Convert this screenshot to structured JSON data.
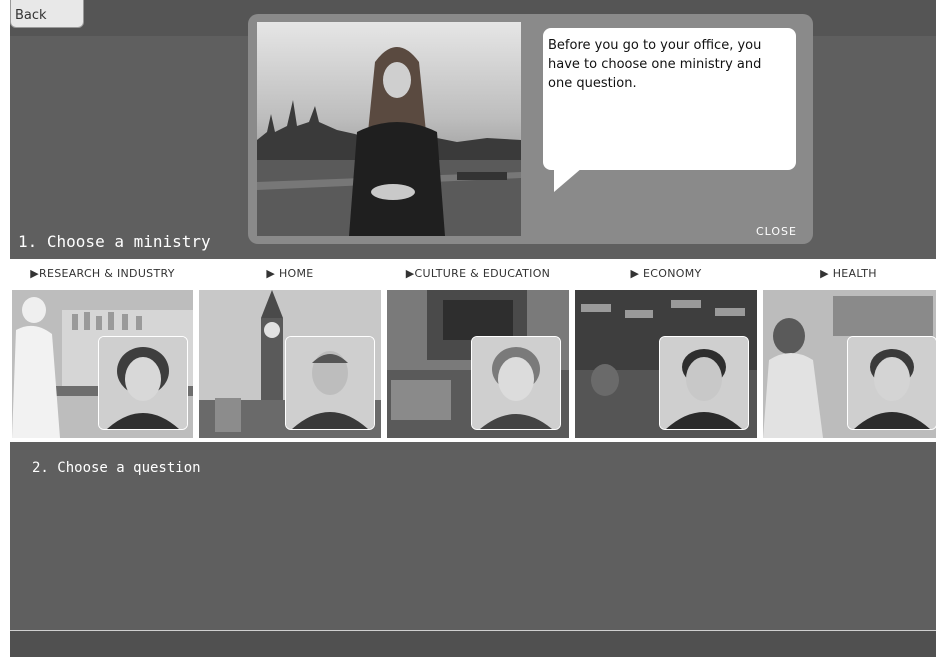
{
  "nav": {
    "back_label": "Back"
  },
  "dialog": {
    "message": "Before you go to your office, you have to choose one ministry and one question.",
    "close_label": "CLOSE"
  },
  "section1": {
    "title": "1. Choose a ministry"
  },
  "ministries": [
    {
      "label": "▶RESEARCH & INDUSTRY"
    },
    {
      "label": "▶ HOME"
    },
    {
      "label": "▶CULTURE & EDUCATION"
    },
    {
      "label": "▶ ECONOMY"
    },
    {
      "label": "▶ HEALTH"
    }
  ],
  "section2": {
    "title": "2. Choose a question"
  }
}
